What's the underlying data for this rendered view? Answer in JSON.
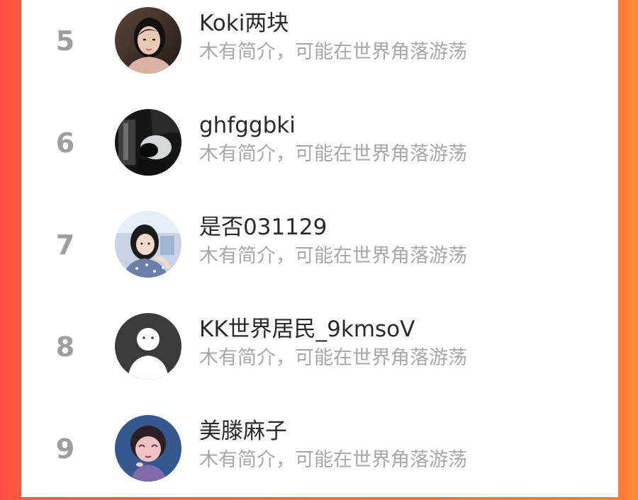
{
  "ranking_list": {
    "rows": [
      {
        "rank": "5",
        "name": "Koki两块",
        "bio": "木有简介，可能在世界角落游荡",
        "avatar_icon": "portrait-photo-icon"
      },
      {
        "rank": "6",
        "name": "ghfggbki",
        "bio": "木有简介，可能在世界角落游荡",
        "avatar_icon": "dark-photo-icon"
      },
      {
        "rank": "7",
        "name": "是否031129",
        "bio": "木有简介，可能在世界角落游荡",
        "avatar_icon": "selfie-photo-icon"
      },
      {
        "rank": "8",
        "name": "KK世界居民_9kmsoV",
        "bio": "木有简介，可能在世界角落游荡",
        "avatar_icon": "default-avatar-icon"
      },
      {
        "rank": "9",
        "name": "美滕麻子",
        "bio": "木有简介，可能在世界角落游荡",
        "avatar_icon": "cartoon-avatar-icon"
      }
    ]
  },
  "colors": {
    "background_left": "#ff4d45",
    "background_right": "#ff8a33",
    "panel": "#ffffff",
    "rank_text": "#9e9e9e",
    "name_text": "#2a2a2a",
    "bio_text": "#a7a7a7"
  }
}
